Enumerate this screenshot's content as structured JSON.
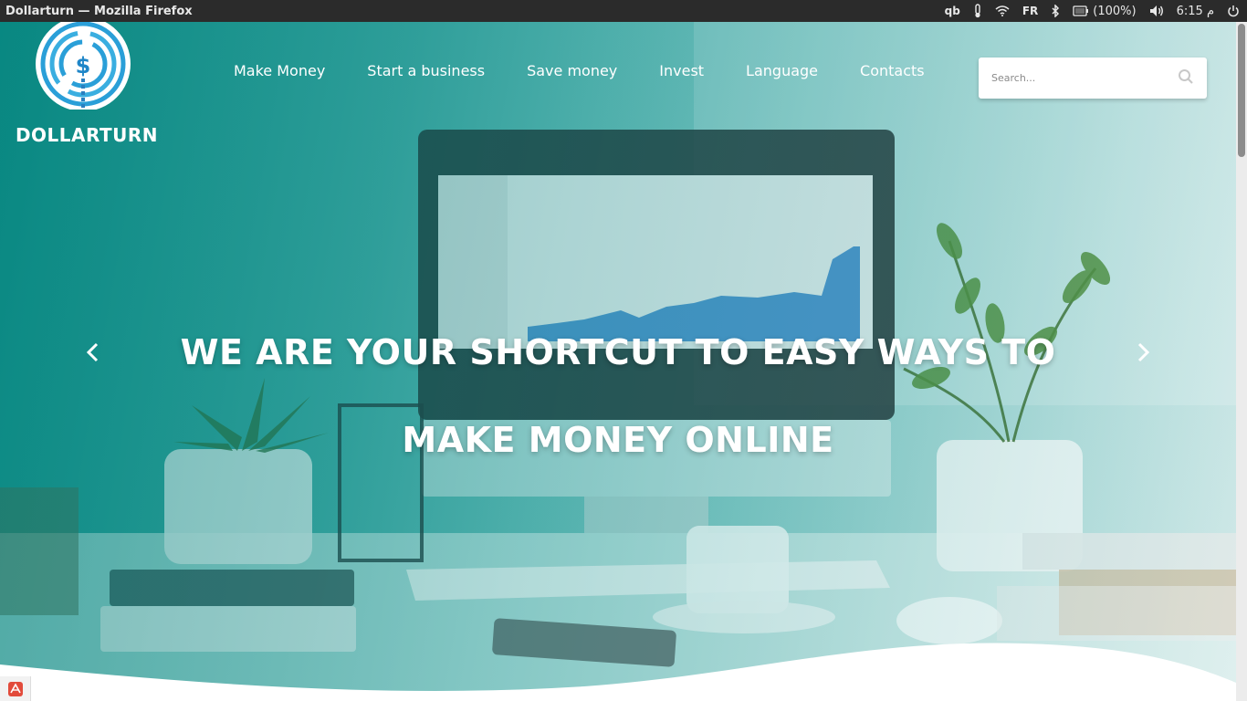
{
  "window": {
    "title": "Dollarturn — Mozilla Firefox"
  },
  "tray": {
    "app_label": "qb",
    "keyboard_layout": "FR",
    "battery": "(100%)",
    "time": "6:15 م",
    "icons": [
      "qbittorrent-icon",
      "thermometer-icon",
      "wifi-icon",
      "bluetooth-icon",
      "battery-icon",
      "volume-icon",
      "power-icon"
    ]
  },
  "site": {
    "brand": "DOLLARTURN",
    "nav": [
      "Make Money",
      "Start a business",
      "Save money",
      "Invest",
      "Language",
      "Contacts"
    ],
    "search": {
      "placeholder": "Search..."
    },
    "hero": {
      "line1": "WE ARE YOUR SHORTCUT TO EASY WAYS TO",
      "line2": "MAKE MONEY ONLINE"
    }
  },
  "colors": {
    "topbar": "#2b2b2b",
    "accent": "#0f8e88",
    "logo_blue": "#2a9fd8"
  }
}
